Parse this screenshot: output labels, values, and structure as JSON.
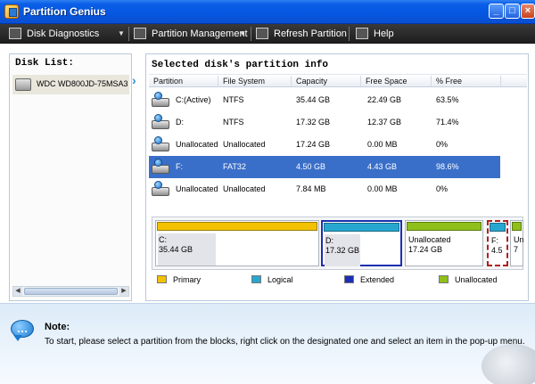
{
  "window": {
    "title": "Partition Genius"
  },
  "toolbar": {
    "items": [
      {
        "label": "Disk Diagnostics",
        "icon": "monitor-icon"
      },
      {
        "label": "Partition Management",
        "icon": "partition-icon"
      },
      {
        "label": "Refresh Partition",
        "icon": "refresh-icon"
      },
      {
        "label": "Help",
        "icon": "help-icon"
      }
    ]
  },
  "disk_list": {
    "title": "Disk List:",
    "disks": [
      {
        "label": "WDC WD800JD-75MSA3"
      }
    ]
  },
  "partitions": {
    "title": "Selected disk's partition info",
    "columns": [
      "Partition",
      "File System",
      "Capacity",
      "Free Space",
      "% Free"
    ],
    "rows": [
      {
        "partition": "C:(Active)",
        "fs": "NTFS",
        "capacity": "35.44 GB",
        "free": "22.49 GB",
        "pct": "63.5%",
        "selected": false
      },
      {
        "partition": "D:",
        "fs": "NTFS",
        "capacity": "17.32 GB",
        "free": "12.37 GB",
        "pct": "71.4%",
        "selected": false
      },
      {
        "partition": "Unallocated",
        "fs": "Unallocated",
        "capacity": "17.24 GB",
        "free": "0.00 MB",
        "pct": "0%",
        "selected": false
      },
      {
        "partition": "F:",
        "fs": "FAT32",
        "capacity": "4.50 GB",
        "free": "4.43 GB",
        "pct": "98.6%",
        "selected": true
      },
      {
        "partition": "Unallocated",
        "fs": "Unallocated",
        "capacity": "7.84 MB",
        "free": "0.00 MB",
        "pct": "0%",
        "selected": false
      }
    ]
  },
  "blocks": [
    {
      "name": "C:",
      "size": "35.44 GB",
      "type": "primary"
    },
    {
      "name": "D:",
      "size": "17.32 GB",
      "type": "logical"
    },
    {
      "name": "Unallocated",
      "size": "17.24 GB",
      "type": "unallocated"
    },
    {
      "name": "F:",
      "size": "4.5",
      "type": "logical"
    },
    {
      "name": "Un",
      "size": "7",
      "type": "unallocated"
    }
  ],
  "legend": [
    {
      "label": "Primary",
      "color": "#f2c200"
    },
    {
      "label": "Logical",
      "color": "#27a7cf"
    },
    {
      "label": "Extended",
      "color": "#1a2fb5"
    },
    {
      "label": "Unallocated",
      "color": "#8fbf1a"
    }
  ],
  "colors": {
    "primary": "#f2c200",
    "logical": "#27a7cf",
    "extended": "#1a2fb5",
    "unallocated": "#8fbf1a",
    "selection": "#3a6fc9"
  },
  "note": {
    "title": "Note:",
    "text": "To start, please select a partition from the blocks, right click on the designated one and select an item in the pop-up menu."
  }
}
